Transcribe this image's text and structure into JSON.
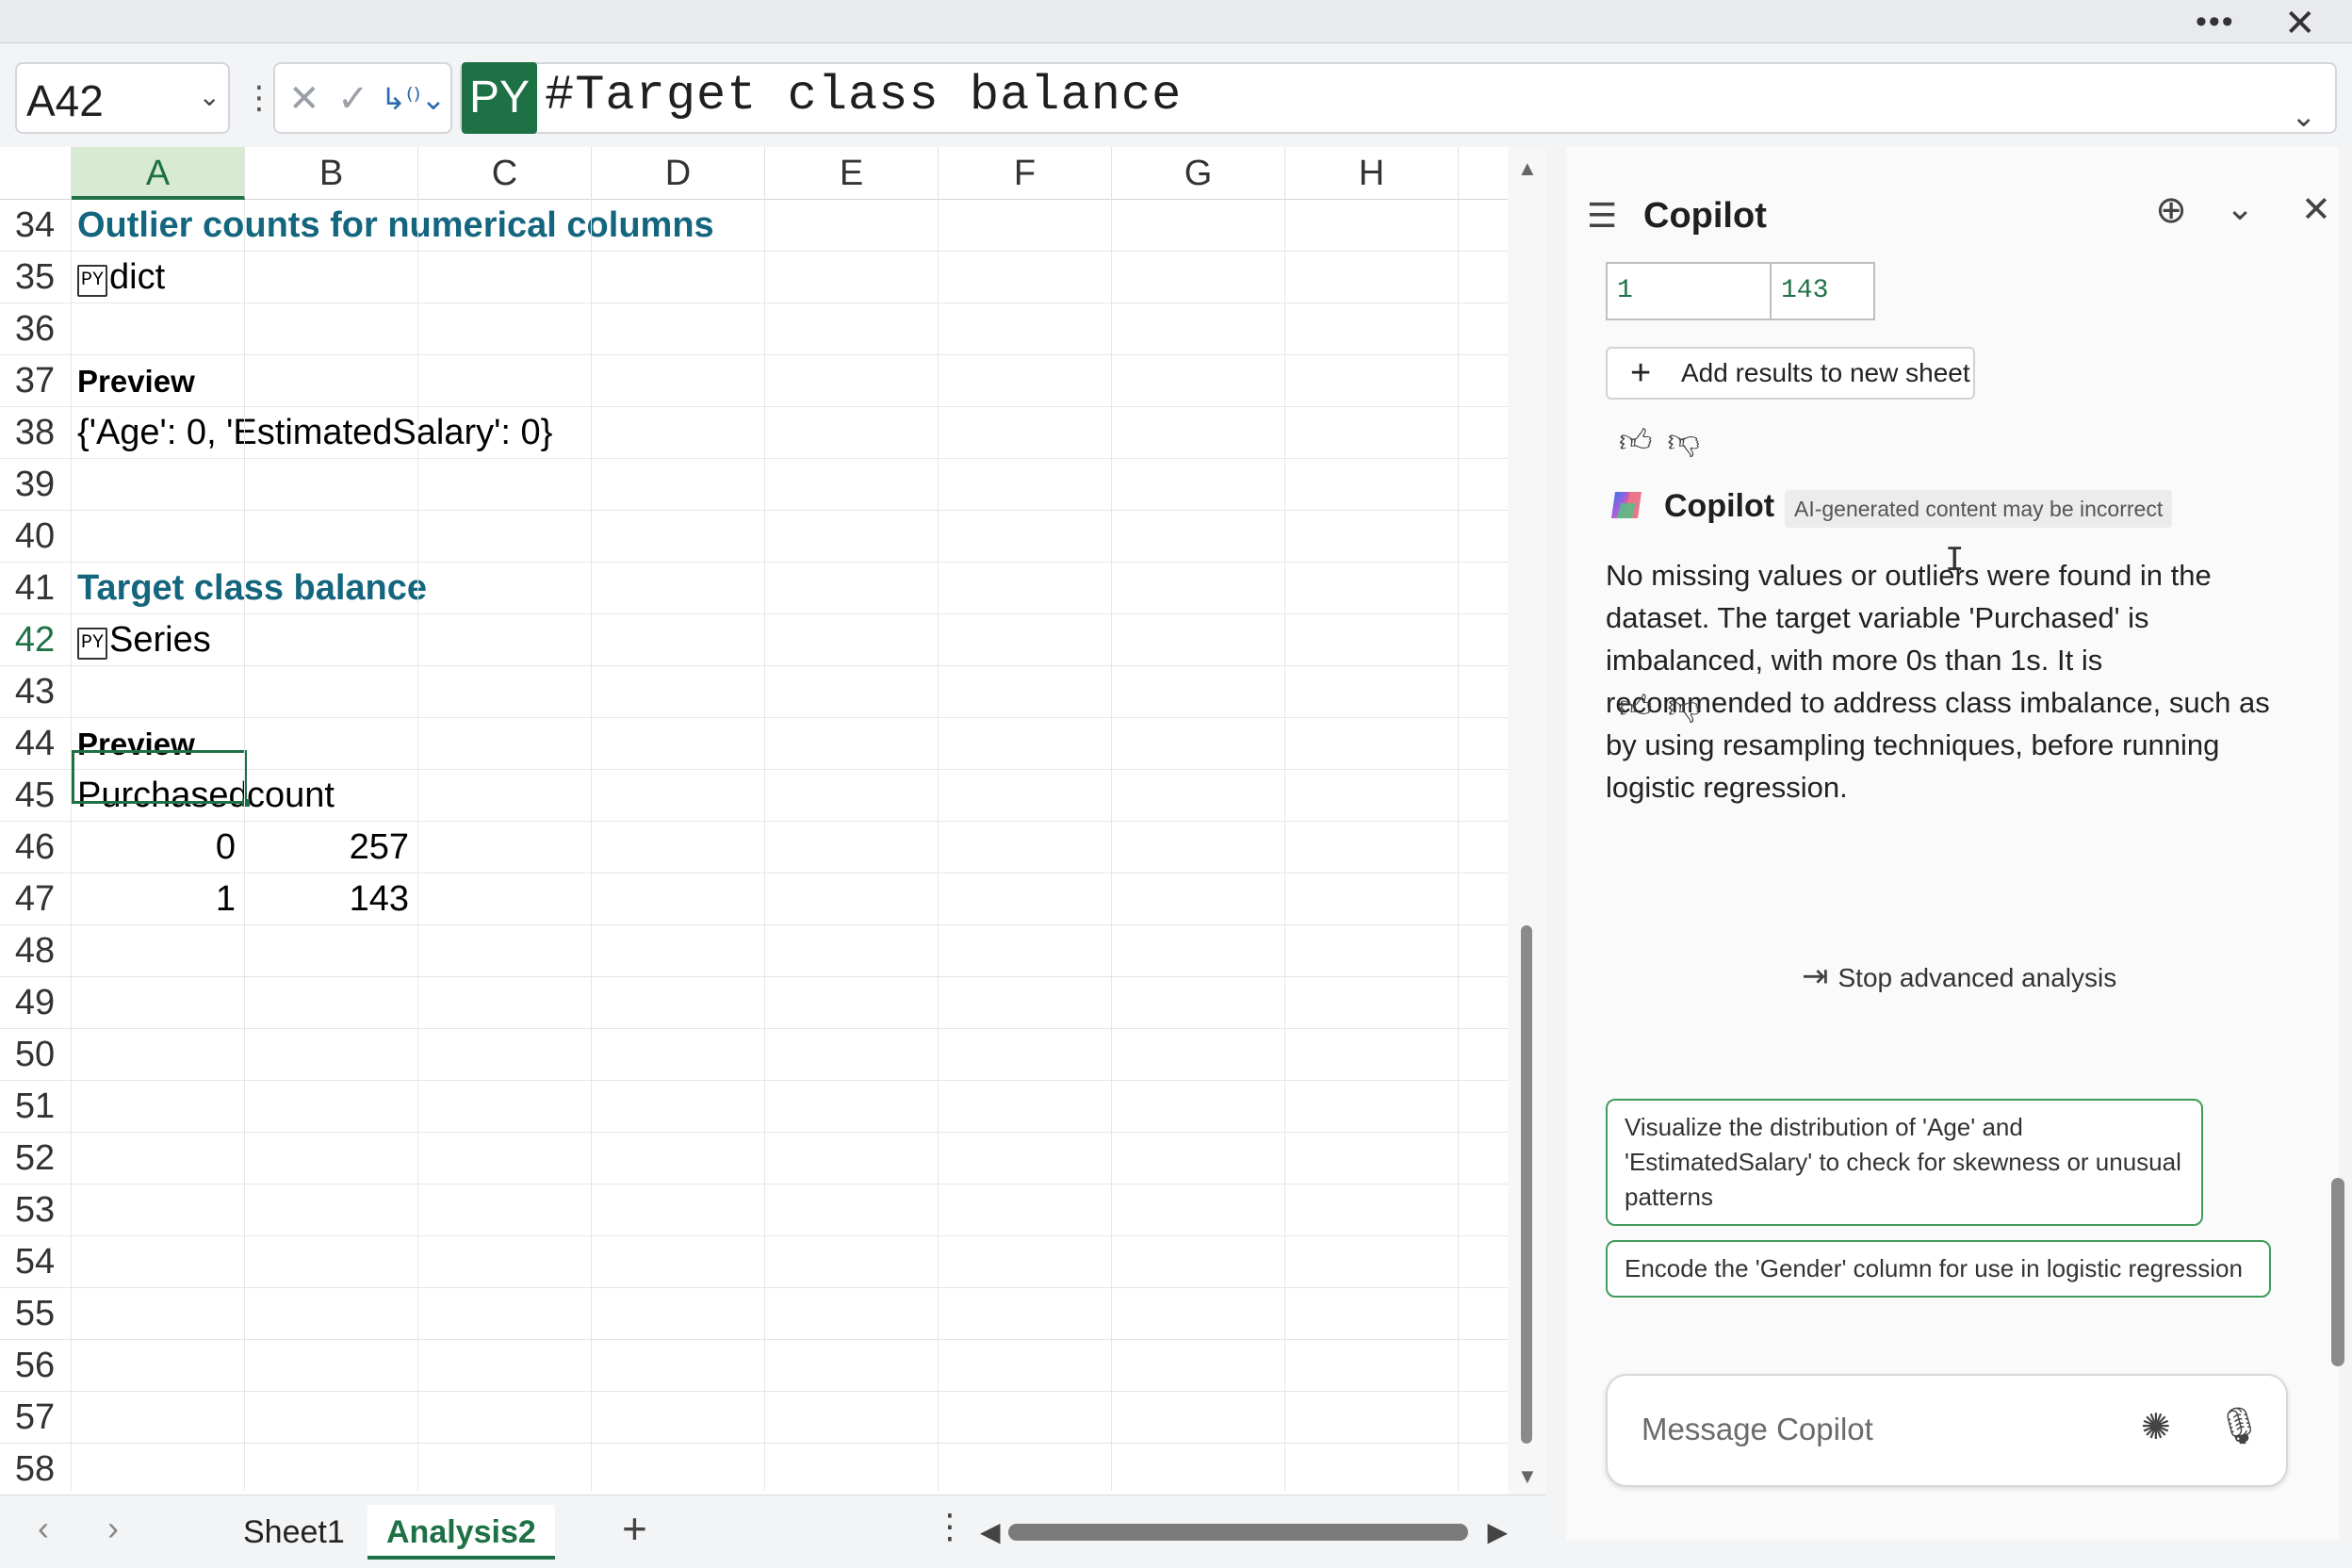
{
  "window": {
    "more_label": "•••",
    "close_label": "✕"
  },
  "formula_bar": {
    "name_box": "A42",
    "py_badge": "PY",
    "formula": "#Target class balance"
  },
  "columns": [
    "A",
    "B",
    "C",
    "D",
    "E",
    "F",
    "G",
    "H"
  ],
  "selected_column": "A",
  "rows": [
    {
      "num": "34",
      "a": "Outlier counts for numerical columns",
      "style": "heading"
    },
    {
      "num": "35",
      "a": "dict",
      "style": "py"
    },
    {
      "num": "36",
      "a": ""
    },
    {
      "num": "37",
      "a": "Preview",
      "style": "bold"
    },
    {
      "num": "38",
      "a": "{'Age': 0, 'EstimatedSalary': 0}"
    },
    {
      "num": "39",
      "a": ""
    },
    {
      "num": "40",
      "a": ""
    },
    {
      "num": "41",
      "a": "Target class balance",
      "style": "heading"
    },
    {
      "num": "42",
      "a": "Series",
      "style": "py"
    },
    {
      "num": "43",
      "a": ""
    },
    {
      "num": "44",
      "a": "Preview",
      "style": "bold"
    },
    {
      "num": "45",
      "a": "Purchased",
      "b": "count"
    },
    {
      "num": "46",
      "a": "0",
      "b": "257"
    },
    {
      "num": "47",
      "a": "1",
      "b": "143"
    },
    {
      "num": "48"
    },
    {
      "num": "49"
    },
    {
      "num": "50"
    },
    {
      "num": "51"
    },
    {
      "num": "52"
    },
    {
      "num": "53"
    },
    {
      "num": "54"
    },
    {
      "num": "55"
    },
    {
      "num": "56"
    },
    {
      "num": "57"
    },
    {
      "num": "58"
    }
  ],
  "py_box_label": "PY",
  "sheet_tabs": [
    {
      "label": "Sheet1",
      "active": false
    },
    {
      "label": "Analysis2",
      "active": true
    }
  ],
  "copilot": {
    "title": "Copilot",
    "mini_table": {
      "c1": "1",
      "c2": "143"
    },
    "add_results_label": "Add results to new sheet",
    "brand_name": "Copilot",
    "disclaimer": "AI-generated content may be incorrect",
    "message": "No missing values or outliers were found in the dataset. The target variable 'Purchased' is imbalanced, with more 0s than 1s. It is recommended to address class imbalance, such as by using resampling techniques, before running logistic regression.",
    "stop_label": "Stop advanced analysis",
    "suggestions": [
      "Visualize the distribution of 'Age' and 'EstimatedSalary' to check for skewness or unusual patterns",
      "Encode the 'Gender' column for use in logistic regression"
    ],
    "composer_placeholder": "Message Copilot"
  },
  "colors": {
    "accent": "#1e7145",
    "heading": "#14667f",
    "suggestion_border": "#3f9d5a"
  }
}
